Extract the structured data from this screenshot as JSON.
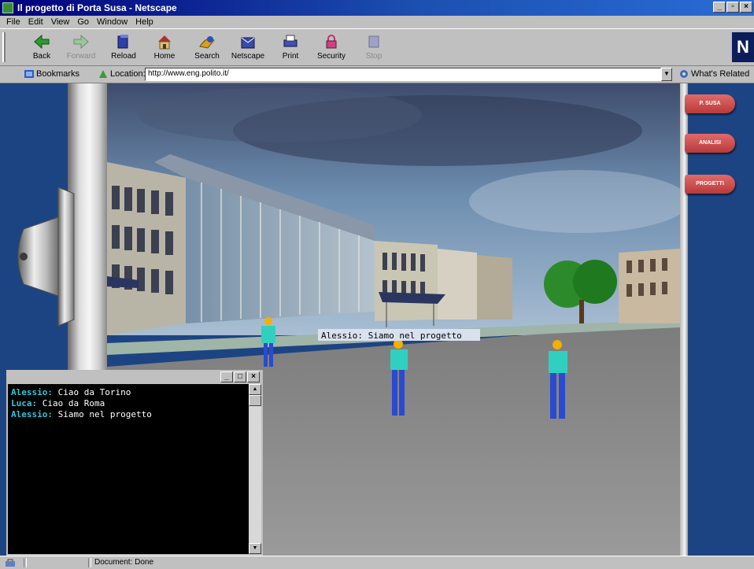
{
  "window": {
    "title": "Il progetto di Porta Susa - Netscape",
    "controls": [
      "_",
      "▫",
      "×"
    ]
  },
  "menu": [
    "File",
    "Edit",
    "View",
    "Go",
    "Window",
    "Help"
  ],
  "toolbar": {
    "buttons": [
      {
        "label": "Back",
        "icon": "back-arrow-icon",
        "enabled": true
      },
      {
        "label": "Forward",
        "icon": "forward-arrow-icon",
        "enabled": false
      },
      {
        "label": "Reload",
        "icon": "reload-icon",
        "enabled": true
      },
      {
        "label": "Home",
        "icon": "home-icon",
        "enabled": true
      },
      {
        "label": "Search",
        "icon": "search-icon",
        "enabled": true
      },
      {
        "label": "Netscape",
        "icon": "netscape-icon",
        "enabled": true
      },
      {
        "label": "Print",
        "icon": "print-icon",
        "enabled": true
      },
      {
        "label": "Security",
        "icon": "security-lock-icon",
        "enabled": true
      },
      {
        "label": "Stop",
        "icon": "stop-icon",
        "enabled": false
      }
    ],
    "logo": "N"
  },
  "location": {
    "bookmarks_label": "Bookmarks",
    "location_label": "Location:",
    "url": "http://www.eng.polito.it/",
    "related_label": "What's Related"
  },
  "side_menu": [
    "P. SUSA",
    "ANALISI",
    "PROGETTI"
  ],
  "scene": {
    "speech": "Alessio: Siamo nel progetto"
  },
  "chat": {
    "controls": [
      "_",
      "□",
      "×"
    ],
    "messages": [
      {
        "user": "Alessio:",
        "text": " Ciao da Torino"
      },
      {
        "user": "Luca:",
        "text": " Ciao da Roma"
      },
      {
        "user": "Alessio:",
        "text": " Siamo nel progetto"
      }
    ]
  },
  "status": {
    "text": "Document: Done"
  },
  "colors": {
    "title_bar": "#00007b",
    "panel_blue": "#1d4482",
    "menu_button": "#c94c4c",
    "chat_username": "#2ec8d8"
  }
}
